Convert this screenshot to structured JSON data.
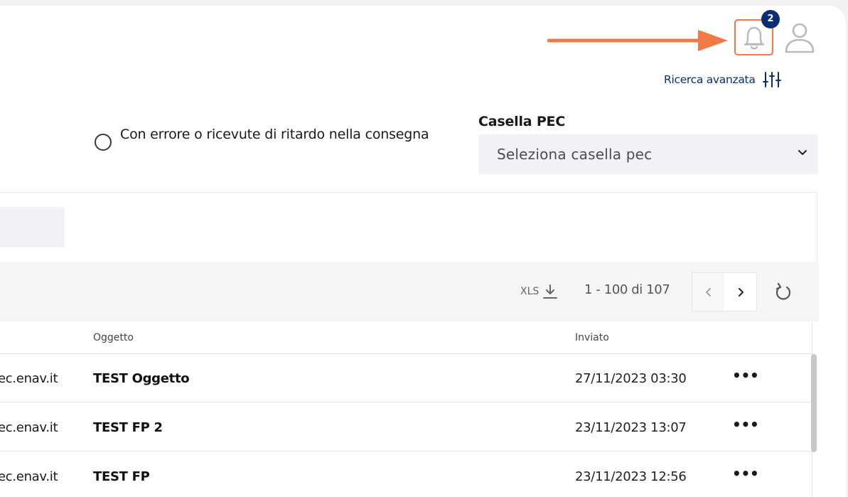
{
  "header": {
    "notifications_count": "2",
    "advanced_search_label": "Ricerca avanzata"
  },
  "filters": {
    "radio_label": "Con errore o ricevute di ritardo nella consegna",
    "pec_label": "Casella PEC",
    "pec_placeholder": "Seleziona casella pec"
  },
  "toolbar": {
    "xls_label": "XLS",
    "pagination": "1 - 100 di 107"
  },
  "table": {
    "columns": [
      "Oggetto",
      "Inviato"
    ],
    "rows": [
      {
        "email": "ec.enav.it",
        "subject": "TEST Oggetto",
        "date": "27/11/2023 03:30",
        "more": "•••"
      },
      {
        "email": "ec.enav.it",
        "subject": "TEST FP 2",
        "date": "23/11/2023 13:07",
        "more": "•••"
      },
      {
        "email": "ec.enav.it",
        "subject": "TEST FP",
        "date": "23/11/2023 12:56",
        "more": "•••"
      }
    ]
  },
  "colors": {
    "accent": "#0b2e70",
    "highlight": "#f07a45"
  },
  "icons": [
    "arrow-icon",
    "bell-icon",
    "user-icon",
    "sliders-icon",
    "chevron-down-icon",
    "download-icon",
    "chevron-left-icon",
    "chevron-right-icon",
    "refresh-icon"
  ]
}
